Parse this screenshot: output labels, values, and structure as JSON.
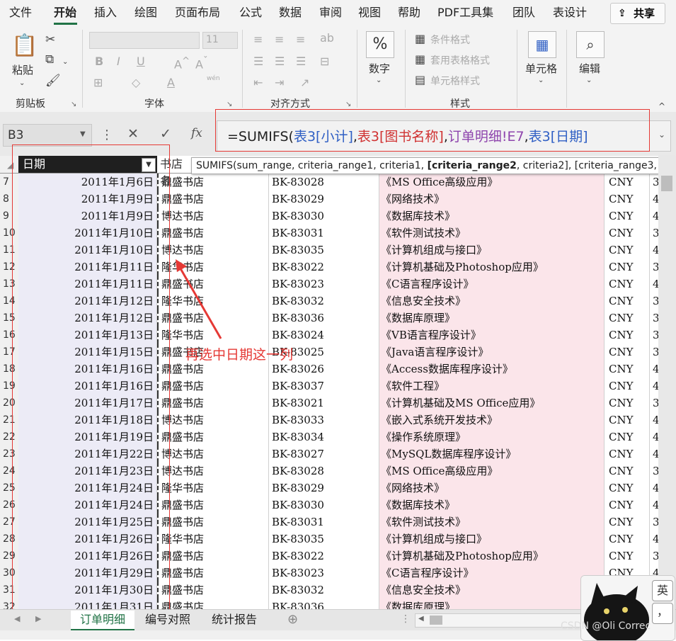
{
  "menu": {
    "items": [
      "文件",
      "开始",
      "插入",
      "绘图",
      "页面布局",
      "公式",
      "数据",
      "审阅",
      "视图",
      "帮助",
      "PDF工具集",
      "团队",
      "表设计"
    ],
    "active": "开始",
    "share_label": "共享"
  },
  "ribbon": {
    "clipboard": {
      "paste_label": "粘贴",
      "group_label": "剪贴板"
    },
    "font": {
      "font_size": "11",
      "group_label": "字体",
      "bold": "B",
      "italic": "I",
      "underline": "U",
      "wen_label": "wén"
    },
    "alignment": {
      "group_label": "对齐方式"
    },
    "number": {
      "symbol": "%",
      "label": "数字"
    },
    "styles": {
      "conditional_format": "条件格式",
      "table_format": "套用表格格式",
      "cell_styles": "单元格样式",
      "group_label": "样式"
    },
    "cells": {
      "label": "单元格"
    },
    "editing": {
      "label": "编辑"
    }
  },
  "formula_bar": {
    "name_box": "B3",
    "fx_label": "fx",
    "formula_parts": [
      {
        "text": "=SUMIFS(",
        "color": "#222222"
      },
      {
        "text": "表3[小计]",
        "color": "#2f5fc4"
      },
      {
        "text": ",",
        "color": "#222222"
      },
      {
        "text": "表3[图书名称]",
        "color": "#d03131"
      },
      {
        "text": ",",
        "color": "#222222"
      },
      {
        "text": "订单明细!E7",
        "color": "#8e44ad"
      },
      {
        "text": ",",
        "color": "#222222"
      },
      {
        "text": "表3[日期]",
        "color": "#2f5fc4"
      }
    ]
  },
  "tooltip": {
    "before": "SUMIFS(sum_range, criteria_range1, criteria1, ",
    "bold": "[criteria_range2",
    "after": ", criteria2], [criteria_range3, ...)"
  },
  "grid": {
    "header_date": "日期",
    "header_store": "书店名",
    "rows": [
      {
        "n": "7",
        "date": "2011年1月6日",
        "store": "鼎盛书店",
        "id": "BK-83028",
        "name": "《MS Office高级应用》",
        "cur": "CNY",
        "tail": "3"
      },
      {
        "n": "8",
        "date": "2011年1月9日",
        "store": "鼎盛书店",
        "id": "BK-83029",
        "name": "《网络技术》",
        "cur": "CNY",
        "tail": "4"
      },
      {
        "n": "9",
        "date": "2011年1月9日",
        "store": "博达书店",
        "id": "BK-83030",
        "name": "《数据库技术》",
        "cur": "CNY",
        "tail": "4"
      },
      {
        "n": "10",
        "date": "2011年1月10日",
        "store": "鼎盛书店",
        "id": "BK-83031",
        "name": "《软件测试技术》",
        "cur": "CNY",
        "tail": "3"
      },
      {
        "n": "11",
        "date": "2011年1月10日",
        "store": "博达书店",
        "id": "BK-83035",
        "name": "《计算机组成与接口》",
        "cur": "CNY",
        "tail": "4"
      },
      {
        "n": "12",
        "date": "2011年1月11日",
        "store": "隆华书店",
        "id": "BK-83022",
        "name": "《计算机基础及Photoshop应用》",
        "cur": "CNY",
        "tail": "3"
      },
      {
        "n": "13",
        "date": "2011年1月11日",
        "store": "鼎盛书店",
        "id": "BK-83023",
        "name": "《C语言程序设计》",
        "cur": "CNY",
        "tail": "4"
      },
      {
        "n": "14",
        "date": "2011年1月12日",
        "store": "隆华书店",
        "id": "BK-83032",
        "name": "《信息安全技术》",
        "cur": "CNY",
        "tail": "3"
      },
      {
        "n": "15",
        "date": "2011年1月12日",
        "store": "鼎盛书店",
        "id": "BK-83036",
        "name": "《数据库原理》",
        "cur": "CNY",
        "tail": "3"
      },
      {
        "n": "16",
        "date": "2011年1月13日",
        "store": "隆华书店",
        "id": "BK-83024",
        "name": "《VB语言程序设计》",
        "cur": "CNY",
        "tail": "3"
      },
      {
        "n": "17",
        "date": "2011年1月15日",
        "store": "鼎盛书店",
        "id": "BK-83025",
        "name": "《Java语言程序设计》",
        "cur": "CNY",
        "tail": "3"
      },
      {
        "n": "18",
        "date": "2011年1月16日",
        "store": "鼎盛书店",
        "id": "BK-83026",
        "name": "《Access数据库程序设计》",
        "cur": "CNY",
        "tail": "4"
      },
      {
        "n": "19",
        "date": "2011年1月16日",
        "store": "鼎盛书店",
        "id": "BK-83037",
        "name": "《软件工程》",
        "cur": "CNY",
        "tail": "4"
      },
      {
        "n": "20",
        "date": "2011年1月17日",
        "store": "鼎盛书店",
        "id": "BK-83021",
        "name": "《计算机基础及MS Office应用》",
        "cur": "CNY",
        "tail": "3"
      },
      {
        "n": "21",
        "date": "2011年1月18日",
        "store": "博达书店",
        "id": "BK-83033",
        "name": "《嵌入式系统开发技术》",
        "cur": "CNY",
        "tail": "4"
      },
      {
        "n": "22",
        "date": "2011年1月19日",
        "store": "鼎盛书店",
        "id": "BK-83034",
        "name": "《操作系统原理》",
        "cur": "CNY",
        "tail": "4"
      },
      {
        "n": "23",
        "date": "2011年1月22日",
        "store": "博达书店",
        "id": "BK-83027",
        "name": "《MySQL数据库程序设计》",
        "cur": "CNY",
        "tail": "4"
      },
      {
        "n": "24",
        "date": "2011年1月23日",
        "store": "博达书店",
        "id": "BK-83028",
        "name": "《MS Office高级应用》",
        "cur": "CNY",
        "tail": "3"
      },
      {
        "n": "25",
        "date": "2011年1月24日",
        "store": "隆华书店",
        "id": "BK-83029",
        "name": "《网络技术》",
        "cur": "CNY",
        "tail": "4"
      },
      {
        "n": "26",
        "date": "2011年1月24日",
        "store": "鼎盛书店",
        "id": "BK-83030",
        "name": "《数据库技术》",
        "cur": "CNY",
        "tail": "4"
      },
      {
        "n": "27",
        "date": "2011年1月25日",
        "store": "鼎盛书店",
        "id": "BK-83031",
        "name": "《软件测试技术》",
        "cur": "CNY",
        "tail": "3"
      },
      {
        "n": "28",
        "date": "2011年1月26日",
        "store": "隆华书店",
        "id": "BK-83035",
        "name": "《计算机组成与接口》",
        "cur": "CNY",
        "tail": "4"
      },
      {
        "n": "29",
        "date": "2011年1月26日",
        "store": "鼎盛书店",
        "id": "BK-83022",
        "name": "《计算机基础及Photoshop应用》",
        "cur": "CNY",
        "tail": "3"
      },
      {
        "n": "30",
        "date": "2011年1月29日",
        "store": "鼎盛书店",
        "id": "BK-83023",
        "name": "《C语言程序设计》",
        "cur": "CNY",
        "tail": "4"
      },
      {
        "n": "31",
        "date": "2011年1月30日",
        "store": "鼎盛书店",
        "id": "BK-83032",
        "name": "《信息安全技术》",
        "cur": "CNY",
        "tail": "3"
      },
      {
        "n": "32",
        "date": "2011年1月31日",
        "store": "鼎盛书店",
        "id": "BK-83036",
        "name": "《数据库原理》",
        "cur": "CNY",
        "tail": "3"
      }
    ]
  },
  "annotation": {
    "text": "再选中日期这一列",
    "color": "#e53935"
  },
  "sheets": {
    "tabs": [
      "订单明细",
      "编号对照",
      "统计报告"
    ],
    "active": "订单明细"
  },
  "widget": {
    "ime_label": "英",
    "punct_label": "，"
  },
  "watermark": "CSDN @Oli Correc",
  "colors": {
    "accent": "#217346",
    "annotation_red": "#e53935",
    "date_column": "#ecebf6",
    "name_column": "#fbe5ea"
  }
}
